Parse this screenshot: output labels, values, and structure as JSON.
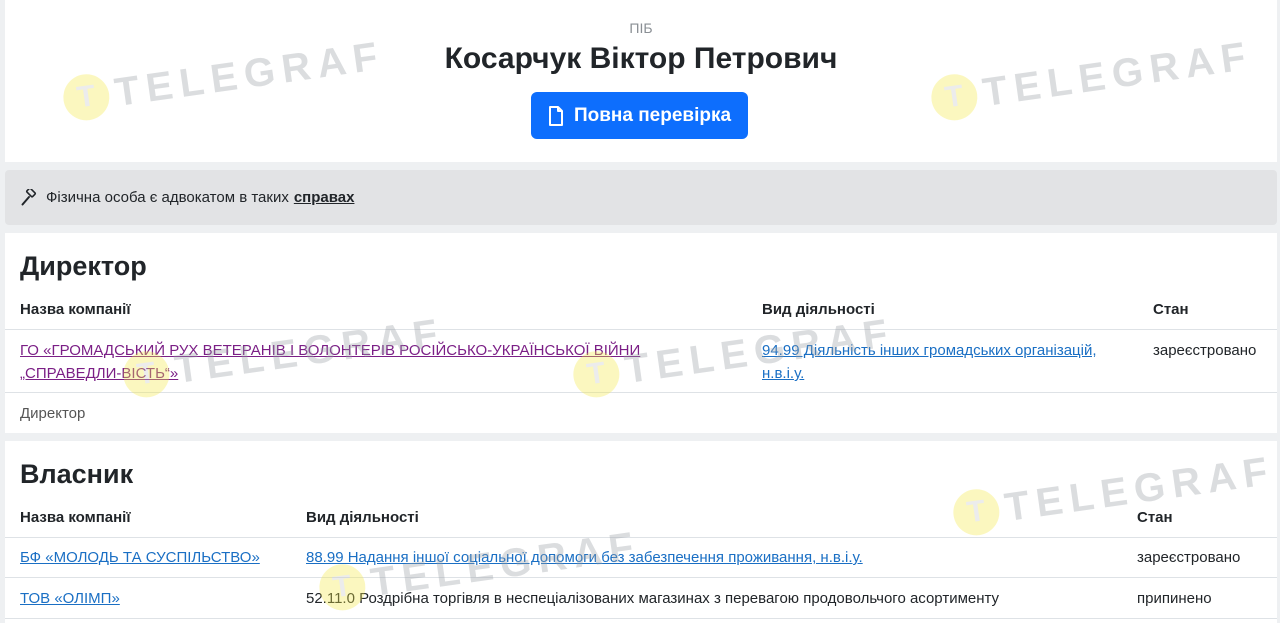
{
  "header": {
    "pib_label": "ПІБ",
    "person_name": "Косарчук Віктор Петрович",
    "check_button": "Повна перевірка"
  },
  "notice": {
    "text": "Фізична особа є адвокатом в таких",
    "link": "справах"
  },
  "director": {
    "title": "Директор",
    "columns": [
      "Назва компанії",
      "Вид діяльності",
      "Стан"
    ],
    "rows": [
      {
        "company": "ГО «ГРОМАДСЬКИЙ РУХ ВЕТЕРАНІВ І ВОЛОНТЕРІВ РОСІЙСЬКО-УКРАЇНСЬКОЇ ВІЙНИ „СПРАВЕДЛИ-ВІСТЬ“»",
        "activity": "94.99 Діяльність інших громадських організацій, н.в.і.у.",
        "status": "зареєстровано",
        "role": "Директор"
      }
    ]
  },
  "owner": {
    "title": "Власник",
    "columns": [
      "Назва компанії",
      "Вид діяльності",
      "Стан"
    ],
    "rows": [
      {
        "company": "БФ «МОЛОДЬ ТА СУСПІЛЬСТВО»",
        "activity": "88.99 Надання іншої соціальної допомоги без забезпечення проживання, н.в.і.у.",
        "status": "зареєстровано"
      },
      {
        "company": "ТОВ «ОЛІМП»",
        "activity": "52.11.0 Роздрібна торгівля в неспеціалізованих магазинах з перевагою продовольчого асортименту",
        "status": "припинено"
      }
    ]
  },
  "watermark": {
    "text": "TELEGRAF",
    "logo_letter": "T"
  },
  "colors": {
    "primary": "#0d6efd",
    "notice_bg": "#e2e3e5",
    "visited_link": "#7b1f86",
    "link": "#1a6fc4",
    "watermark_logo": "#f4ea4a"
  }
}
